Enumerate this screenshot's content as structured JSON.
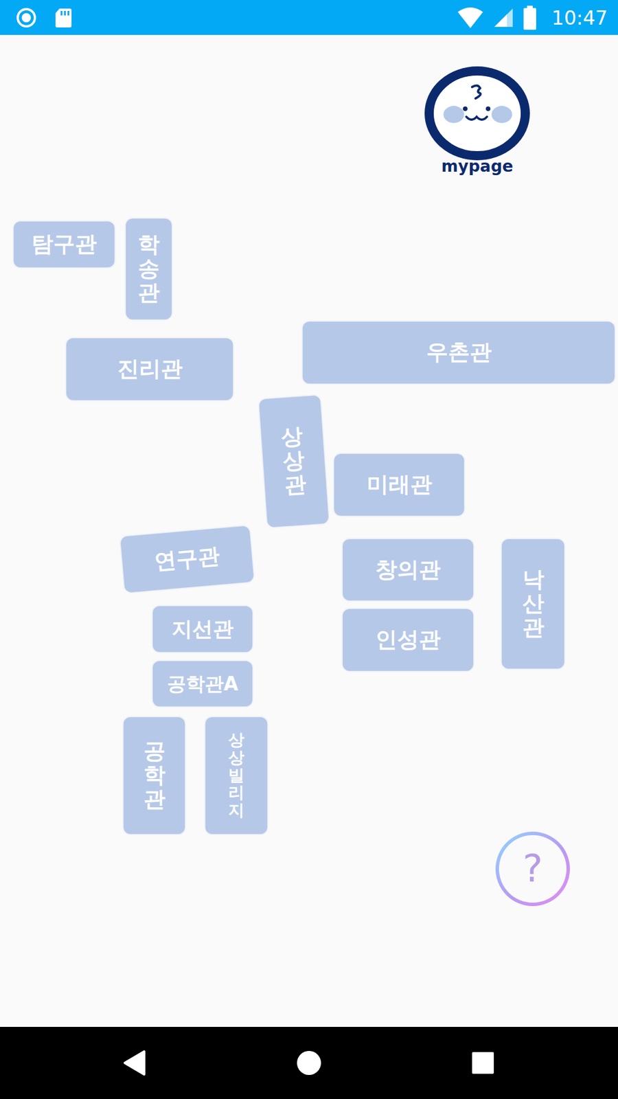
{
  "status_bar": {
    "time": "10:47"
  },
  "profile": {
    "label": "mypage"
  },
  "buildings": [
    {
      "name": "탐구관",
      "kind": "horizontal"
    },
    {
      "name": "학송관",
      "kind": "vertical"
    },
    {
      "name": "진리관",
      "kind": "horizontal"
    },
    {
      "name": "우촌관",
      "kind": "horizontal"
    },
    {
      "name": "상상관",
      "kind": "vertical"
    },
    {
      "name": "미래관",
      "kind": "horizontal"
    },
    {
      "name": "연구관",
      "kind": "horizontal"
    },
    {
      "name": "창의관",
      "kind": "horizontal"
    },
    {
      "name": "낙산관",
      "kind": "vertical"
    },
    {
      "name": "인성관",
      "kind": "horizontal"
    },
    {
      "name": "지선관",
      "kind": "horizontal"
    },
    {
      "name": "공학관A",
      "kind": "horizontal"
    },
    {
      "name": "공학관",
      "kind": "vertical"
    },
    {
      "name": "상상빌리지",
      "kind": "vertical"
    }
  ],
  "help_button": {
    "label": "?"
  }
}
